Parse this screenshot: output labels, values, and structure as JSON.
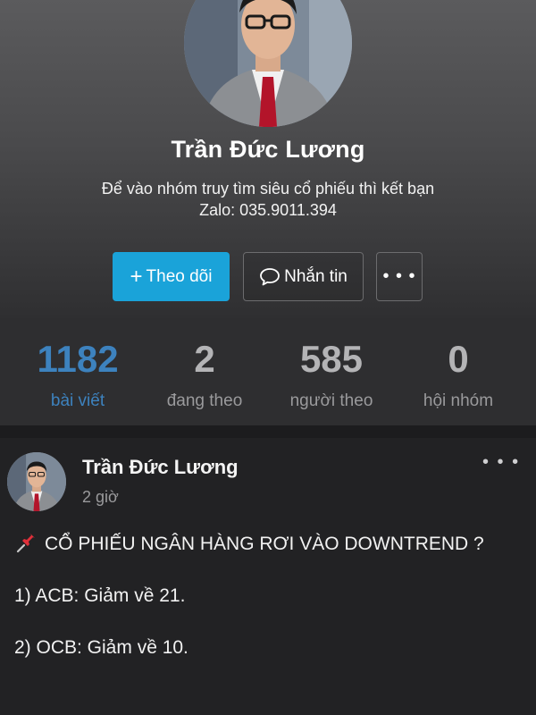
{
  "profile": {
    "name": "Trần Đức Lương",
    "bio_line1": "Để vào nhóm truy tìm siêu cổ phiếu thì kết bạn",
    "bio_line2": "Zalo: 035.9011.394",
    "avatar_icon": "person-photo-avatar"
  },
  "actions": {
    "follow_label": "Theo dõi",
    "follow_icon": "plus-icon",
    "message_label": "Nhắn tin",
    "message_icon": "speech-bubble-icon",
    "more_label": "• • •",
    "accent_color": "#1aa3d9"
  },
  "stats": [
    {
      "value": "1182",
      "label": "bài viết"
    },
    {
      "value": "2",
      "label": "đang theo"
    },
    {
      "value": "585",
      "label": "người theo"
    },
    {
      "value": "0",
      "label": "hội nhóm"
    }
  ],
  "post": {
    "author": "Trần Đức Lương",
    "time": "2 giờ",
    "more_label": "• • •",
    "pin_icon": "pushpin-icon",
    "lines": [
      "CỔ PHIẾU NGÂN HÀNG RƠI VÀO DOWNTREND ?",
      "1) ACB: Giảm về 21.",
      "2) OCB: Giảm về 10."
    ]
  }
}
